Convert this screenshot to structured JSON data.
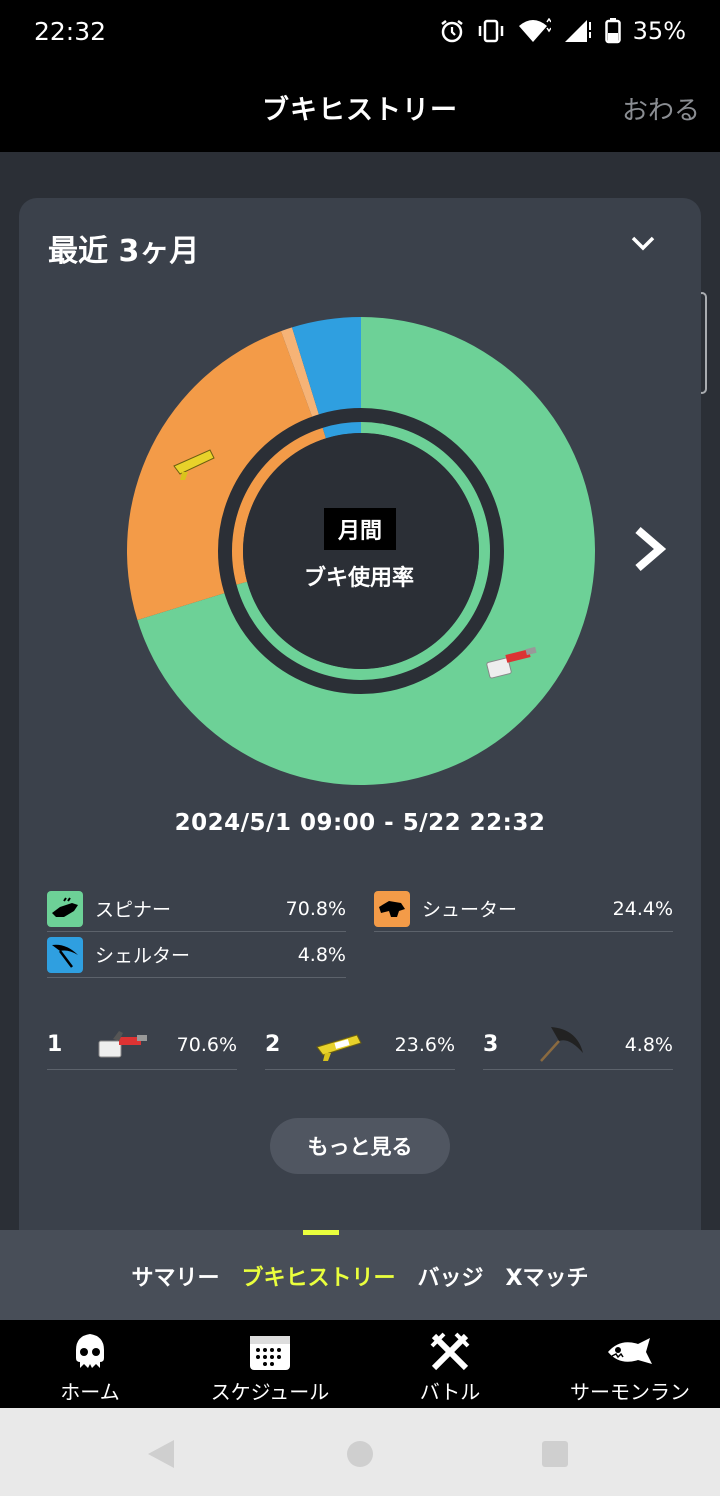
{
  "status": {
    "time": "22:32",
    "battery": "35%"
  },
  "header": {
    "title": "ブキヒストリー",
    "close_label": "おわる"
  },
  "card": {
    "period_title": "最近 3ヶ月",
    "center_badge": "月間",
    "center_label": "ブキ使用率",
    "date_range": "2024/5/1 09:00 - 5/22 22:32"
  },
  "chart_data": {
    "type": "pie",
    "title": "ブキ使用率",
    "outer_ring": [
      {
        "label": "スピナー",
        "value": 70.8,
        "color": "#6dd197"
      },
      {
        "label": "シューター",
        "value": 24.4,
        "color": "#f39b48"
      },
      {
        "label": "シューター (light)",
        "value": 0.8,
        "color": "#f6b376"
      },
      {
        "label": "シェルター",
        "value": 4.8,
        "color": "#2f9fe0"
      }
    ],
    "inner_ring": [
      {
        "label": "スピナー",
        "value": 70.8,
        "color": "#6dd197"
      },
      {
        "label": "シューター",
        "value": 24.4,
        "color": "#f39b48"
      },
      {
        "label": "シェルター",
        "value": 4.8,
        "color": "#2f9fe0"
      }
    ]
  },
  "weapon_types": [
    {
      "name": "スピナー",
      "pct": "70.8%",
      "color": "#6dd197",
      "icon": "spinner-icon"
    },
    {
      "name": "シューター",
      "pct": "24.4%",
      "color": "#f39b48",
      "icon": "shooter-icon"
    },
    {
      "name": "シェルター",
      "pct": "4.8%",
      "color": "#2f9fe0",
      "icon": "brella-icon"
    }
  ],
  "top_weapons": [
    {
      "rank": "1",
      "pct": "70.6%",
      "icon": "spinner-weapon-icon"
    },
    {
      "rank": "2",
      "pct": "23.6%",
      "icon": "shooter-weapon-icon"
    },
    {
      "rank": "3",
      "pct": "4.8%",
      "icon": "brella-weapon-icon"
    }
  ],
  "more_label": "もっと見る",
  "tabs": [
    {
      "label": "サマリー"
    },
    {
      "label": "ブキヒストリー"
    },
    {
      "label": "バッジ"
    },
    {
      "label": "Xマッチ"
    }
  ],
  "bottom_nav": [
    {
      "label": "ホーム"
    },
    {
      "label": "スケジュール"
    },
    {
      "label": "バトル"
    },
    {
      "label": "サーモンラン"
    }
  ]
}
